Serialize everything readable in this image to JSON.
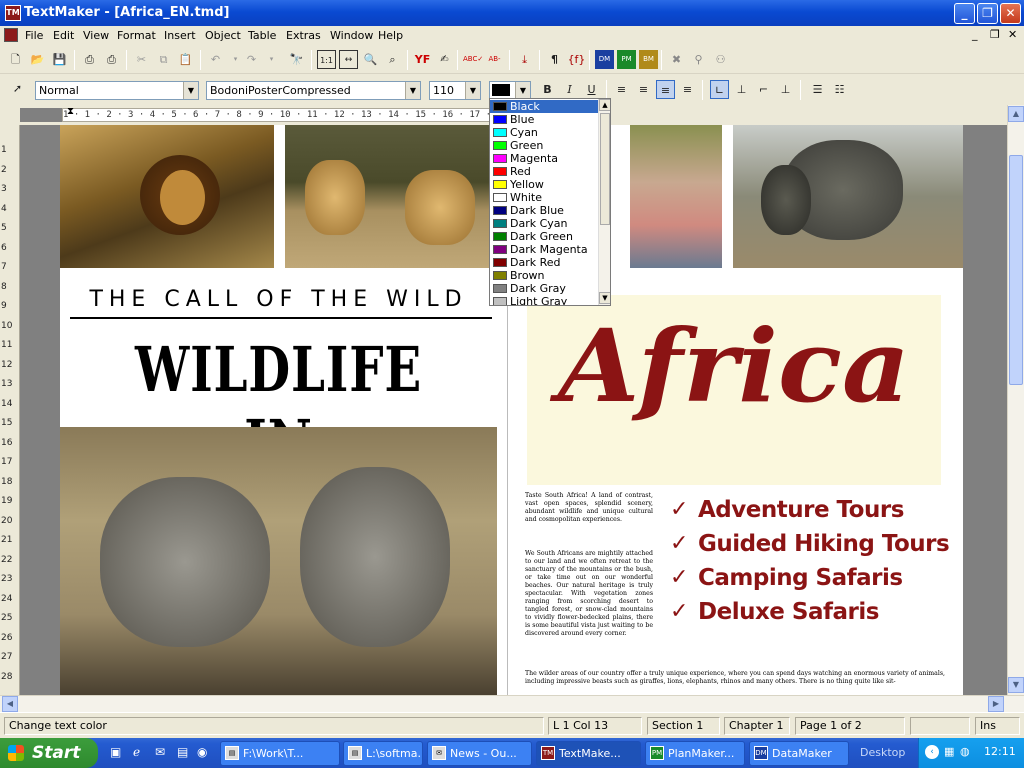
{
  "window": {
    "title": "TextMaker - [Africa_EN.tmd]",
    "app_icon_text": "TM"
  },
  "menu": [
    "File",
    "Edit",
    "View",
    "Format",
    "Insert",
    "Object",
    "Table",
    "Extras",
    "Window",
    "Help"
  ],
  "toolbar2": {
    "style": "Normal",
    "font": "BodoniPosterCompressed",
    "size": "110",
    "bold": "B",
    "italic": "I",
    "underline": "U"
  },
  "ruler_text": "1 · 1 · 2 · 3 · 4 · 5 · 6 · 7 · 8 · 9 · 10 · 11 · 12 · 13 · 14 · 15 · 16 · 17 · 18 · 19 · 20",
  "vruler": [
    "1",
    "2",
    "3",
    "4",
    "5",
    "6",
    "7",
    "8",
    "9",
    "10",
    "11",
    "12",
    "13",
    "14",
    "15",
    "16",
    "17",
    "18",
    "19",
    "20",
    "21",
    "22",
    "23",
    "24",
    "25",
    "26",
    "27",
    "28"
  ],
  "colors": [
    {
      "name": "Black",
      "hex": "#000000"
    },
    {
      "name": "Blue",
      "hex": "#0000ff"
    },
    {
      "name": "Cyan",
      "hex": "#00ffff"
    },
    {
      "name": "Green",
      "hex": "#00ff00"
    },
    {
      "name": "Magenta",
      "hex": "#ff00ff"
    },
    {
      "name": "Red",
      "hex": "#ff0000"
    },
    {
      "name": "Yellow",
      "hex": "#ffff00"
    },
    {
      "name": "White",
      "hex": "#ffffff"
    },
    {
      "name": "Dark Blue",
      "hex": "#000080"
    },
    {
      "name": "Dark Cyan",
      "hex": "#008080"
    },
    {
      "name": "Dark Green",
      "hex": "#008000"
    },
    {
      "name": "Dark Magenta",
      "hex": "#800080"
    },
    {
      "name": "Dark Red",
      "hex": "#800000"
    },
    {
      "name": "Brown",
      "hex": "#808000"
    },
    {
      "name": "Dark Gray",
      "hex": "#808080"
    },
    {
      "name": "Light Gray",
      "hex": "#c0c0c0"
    }
  ],
  "document": {
    "call_of_wild": "THE CALL OF THE WILD",
    "wildlife_in": "WILDLIFE IN",
    "africa": "Africa",
    "body1": "Taste South Africa! A land of contrast, vast open spaces, splendid scenery, abundant wildlife and unique cultural and cosmopolitan experiences.",
    "body2": "We South Africans are mightily attached to our land and we often retreat to the sanctuary of the mountains or the bush, or take time out on our wonderful beaches. Our natural heritage is truly spectacular. With vegetation zones ranging from scorching desert to tangled forest, or snow-clad mountains to vividly flower-bedecked plains, there is some beautiful vista just waiting to be discovered around every corner.",
    "body3": "The wilder areas of our country offer a truly unique experience, where you can spend days watching an enormous variety of animals, including impressive beasts such as giraffes, lions, elephants, rhinos and many others. There is no thing quite like sit-",
    "tours": [
      "Adventure Tours",
      "Guided Hiking Tours",
      "Camping Safaris",
      "Deluxe Safaris"
    ],
    "check": "✓"
  },
  "status": {
    "hint": "Change text color",
    "pos": "L 1 Col 13",
    "section": "Section 1",
    "chapter": "Chapter 1",
    "page": "Page 1 of 2",
    "mode": "Ins"
  },
  "taskbar": {
    "start": "Start",
    "tasks": [
      "F:\\Work\\T...",
      "L:\\softma...",
      "News - Ou...",
      "TextMake...",
      "PlanMaker...",
      "DataMaker"
    ],
    "desktop": "Desktop",
    "clock": "12:11"
  },
  "accent": {
    "title_blue": "#0a4ad2",
    "africa_red": "#8b1414",
    "cream": "#fbf8dd"
  }
}
